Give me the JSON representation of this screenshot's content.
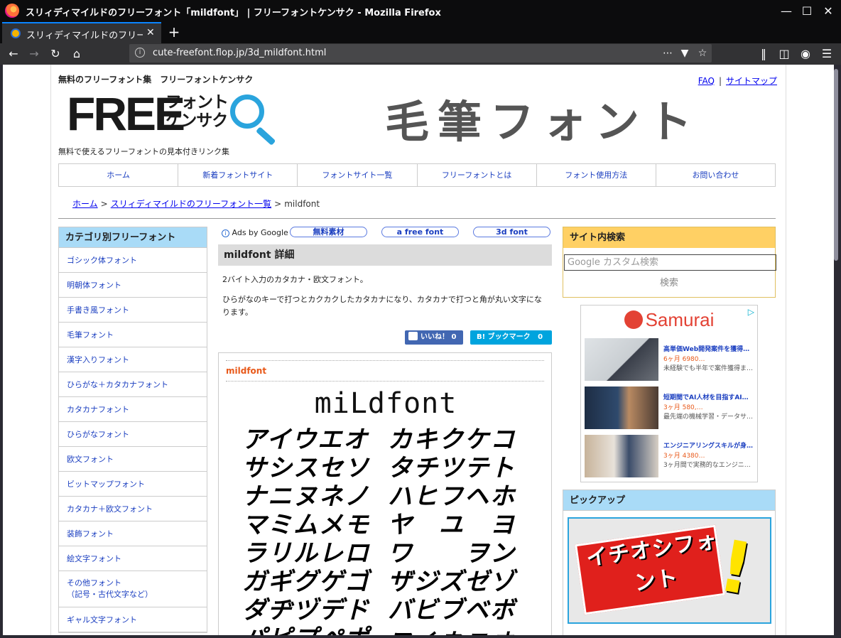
{
  "window": {
    "title": "スリィディマイルドのフリーフォント「mildfont」 | フリーフォントケンサク - Mozilla Firefox"
  },
  "tab": {
    "title": "スリィディマイルドのフリーフ…"
  },
  "urlbar": {
    "url": "cute-freefont.flop.jp/3d_mildfont.html"
  },
  "header": {
    "tagline": "無料のフリーフォント集　フリーフォントケンサク",
    "logo_free": "FREE",
    "logo_line1": "フォント",
    "logo_line2": "ケンサク",
    "subtagline": "無料で使えるフリーフォントの見本付きリンク集",
    "banner": "毛筆フォント",
    "links": [
      "FAQ",
      "サイトマップ"
    ],
    "link_separator": "|"
  },
  "global_nav": [
    "ホーム",
    "新着フォントサイト",
    "フォントサイト一覧",
    "フリーフォントとは",
    "フォント使用方法",
    "お問い合わせ"
  ],
  "breadcrumb": {
    "home": "ホーム",
    "separator": ">",
    "parent": "スリィディマイルドのフリーフォント一覧",
    "current": "mildfont"
  },
  "left_sidebar": {
    "heading": "カテゴリ別フリーフォント",
    "items": [
      "ゴシック体フォント",
      "明朝体フォント",
      "手書き風フォント",
      "毛筆フォント",
      "漢字入りフォント",
      "ひらがな＋カタカナフォント",
      "カタカナフォント",
      "ひらがなフォント",
      "欧文フォント",
      "ビットマップフォント",
      "カタカナ＋欧文フォント",
      "装飾フォント",
      "絵文字フォント",
      "その他フォント",
      "ギャル文字フォント"
    ],
    "item_note": "（記号・古代文字など）"
  },
  "main": {
    "ads_label": "Ads by Google",
    "ad_links": [
      "無料素材",
      "a free font",
      "3d font"
    ],
    "title": "mildfont 詳細",
    "description1": "2バイト入力のカタカナ・欧文フォント。",
    "description2": "ひらがなのキーで打つとカクカクしたカタカナになり、カタカナで打つと角が丸い文字になります。",
    "like_label": "いいね！",
    "like_count": "0",
    "bookmark_label": "B! ブックマーク",
    "bookmark_count": "0",
    "sample_title": "mildfont",
    "sample_heading": "miLdfont",
    "sample_rows": [
      [
        "アイウエオ",
        "カキクケコ"
      ],
      [
        "サシスセソ",
        "タチツテト"
      ],
      [
        "ナニヌネノ",
        "ハヒフヘホ"
      ],
      [
        "マミムメモ",
        "ヤ　ユ　ヨ"
      ],
      [
        "ラリルレロ",
        "ワ　　ヲン"
      ],
      [
        "ガギグゲゴ",
        "ザジズゼゾ"
      ],
      [
        "ダヂヅデド",
        "バビブベボ"
      ],
      [
        "パピプペポ",
        "ァィゥェォ"
      ]
    ]
  },
  "right_sidebar": {
    "search_heading": "サイト内検索",
    "search_placeholder": "Google カスタム検索",
    "search_button": "検索",
    "ad": {
      "brand": "Samurai",
      "items": [
        {
          "title": "高単価Web開発案件を獲得…",
          "price": "6ヶ月 6980…",
          "desc": "未経験でも半年で案件獲得ま…"
        },
        {
          "title": "短期間でAI人材を目指すAI…",
          "price": "3ヶ月 580,…",
          "desc": "最先端の機械学習・データサ…"
        },
        {
          "title": "エンジニアリングスキルが身…",
          "price": "3ヶ月 4380…",
          "desc": "3ヶ月間で実務的なエンジニ…"
        }
      ]
    },
    "pickup_heading": "ピックアップ",
    "pickup_text": "イチオシフォント",
    "pickup_mark": "!"
  }
}
